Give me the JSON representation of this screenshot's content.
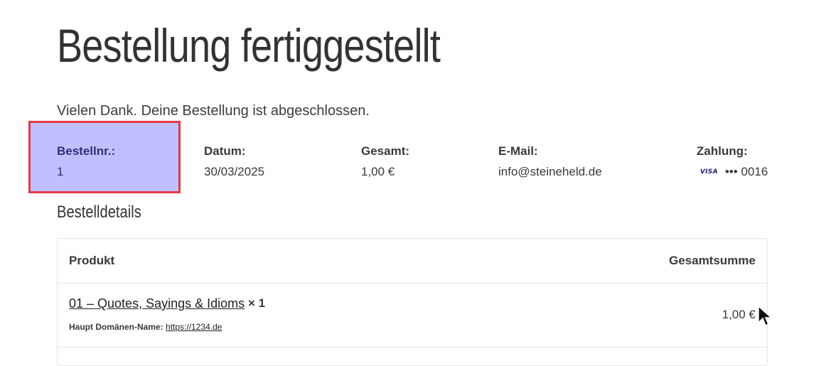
{
  "page": {
    "title": "Bestellung fertiggestellt",
    "thanks": "Vielen Dank. Deine Bestellung ist abgeschlossen."
  },
  "overview": {
    "order": {
      "label": "Bestellnr.:",
      "value": "1"
    },
    "date": {
      "label": "Datum:",
      "value": "30/03/2025"
    },
    "total": {
      "label": "Gesamt:",
      "value": "1,00 €"
    },
    "email": {
      "label": "E-Mail:",
      "value": "info@steineheld.de"
    },
    "payment": {
      "label": "Zahlung:",
      "card_brand": "VISA",
      "card_digits": "••• 0016",
      "card_icon": "visa-card-icon"
    },
    "highlight_color": "#c0c0ff",
    "highlight_border": "#e53945"
  },
  "details": {
    "title": "Bestelldetails",
    "headers": {
      "product": "Produkt",
      "total": "Gesamtsumme"
    },
    "rows": [
      {
        "product": "01 – Quotes, Sayings & Idioms",
        "qty": "× 1",
        "meta_key": "Haupt Domänen-Name:",
        "meta_value": "https://1234.de",
        "total": "1,00 €"
      }
    ]
  }
}
